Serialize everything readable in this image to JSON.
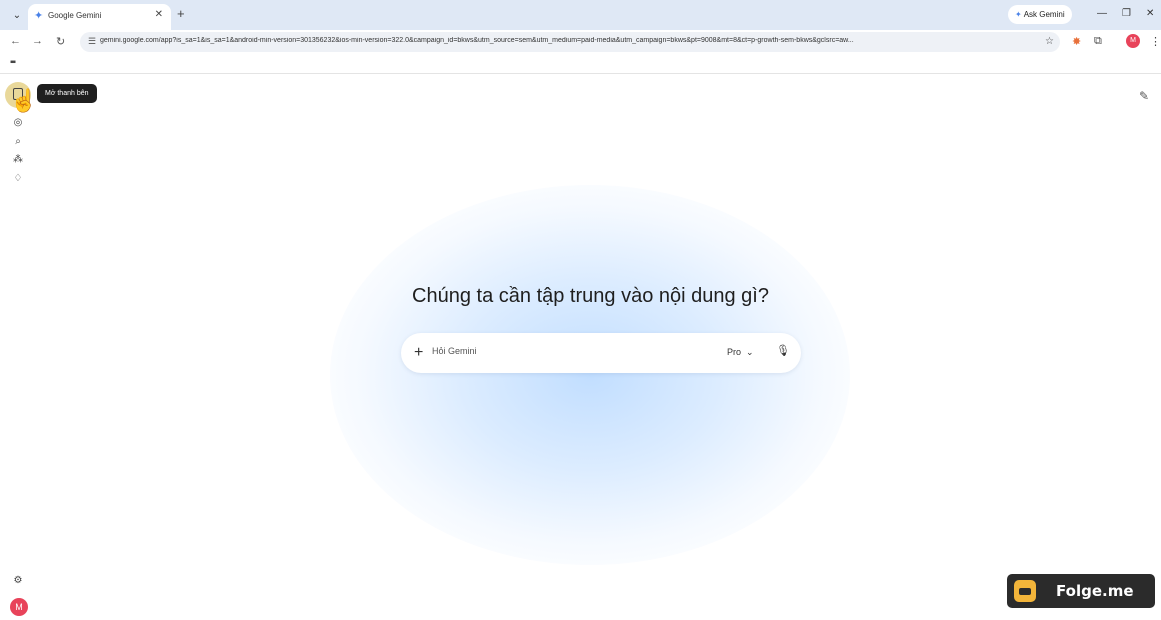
{
  "browser": {
    "tab_menu_icon": "chevron-down-icon",
    "tab": {
      "title": "Google Gemini",
      "favicon": "gemini-spark-icon"
    },
    "ask_gemini_label": "Ask Gemini",
    "url": "gemini.google.com/app?is_sa=1&is_sa=1&android-min-version=301356232&ios-min-version=322.0&campaign_id=bkws&utm_source=sem&utm_medium=paid-media&utm_campaign=bkws&pt=9008&mt=8&ct=p-growth-sem-bkws&gclsrc=aw...",
    "profile_initial": "M"
  },
  "sidebar": {
    "tooltip": "Mở thanh bên",
    "user_initial": "M"
  },
  "main": {
    "headline": "Chúng ta cần tập trung vào nội dung gì?",
    "prompt_placeholder": "Hỏi Gemini",
    "model_label": "Pro"
  },
  "watermark": {
    "text": "Folge.me"
  },
  "colors": {
    "accent": "#4a82e8",
    "avatar": "#e8435a",
    "tooltip_bg": "#1f1f1f",
    "glow": "#cfe3ff"
  }
}
